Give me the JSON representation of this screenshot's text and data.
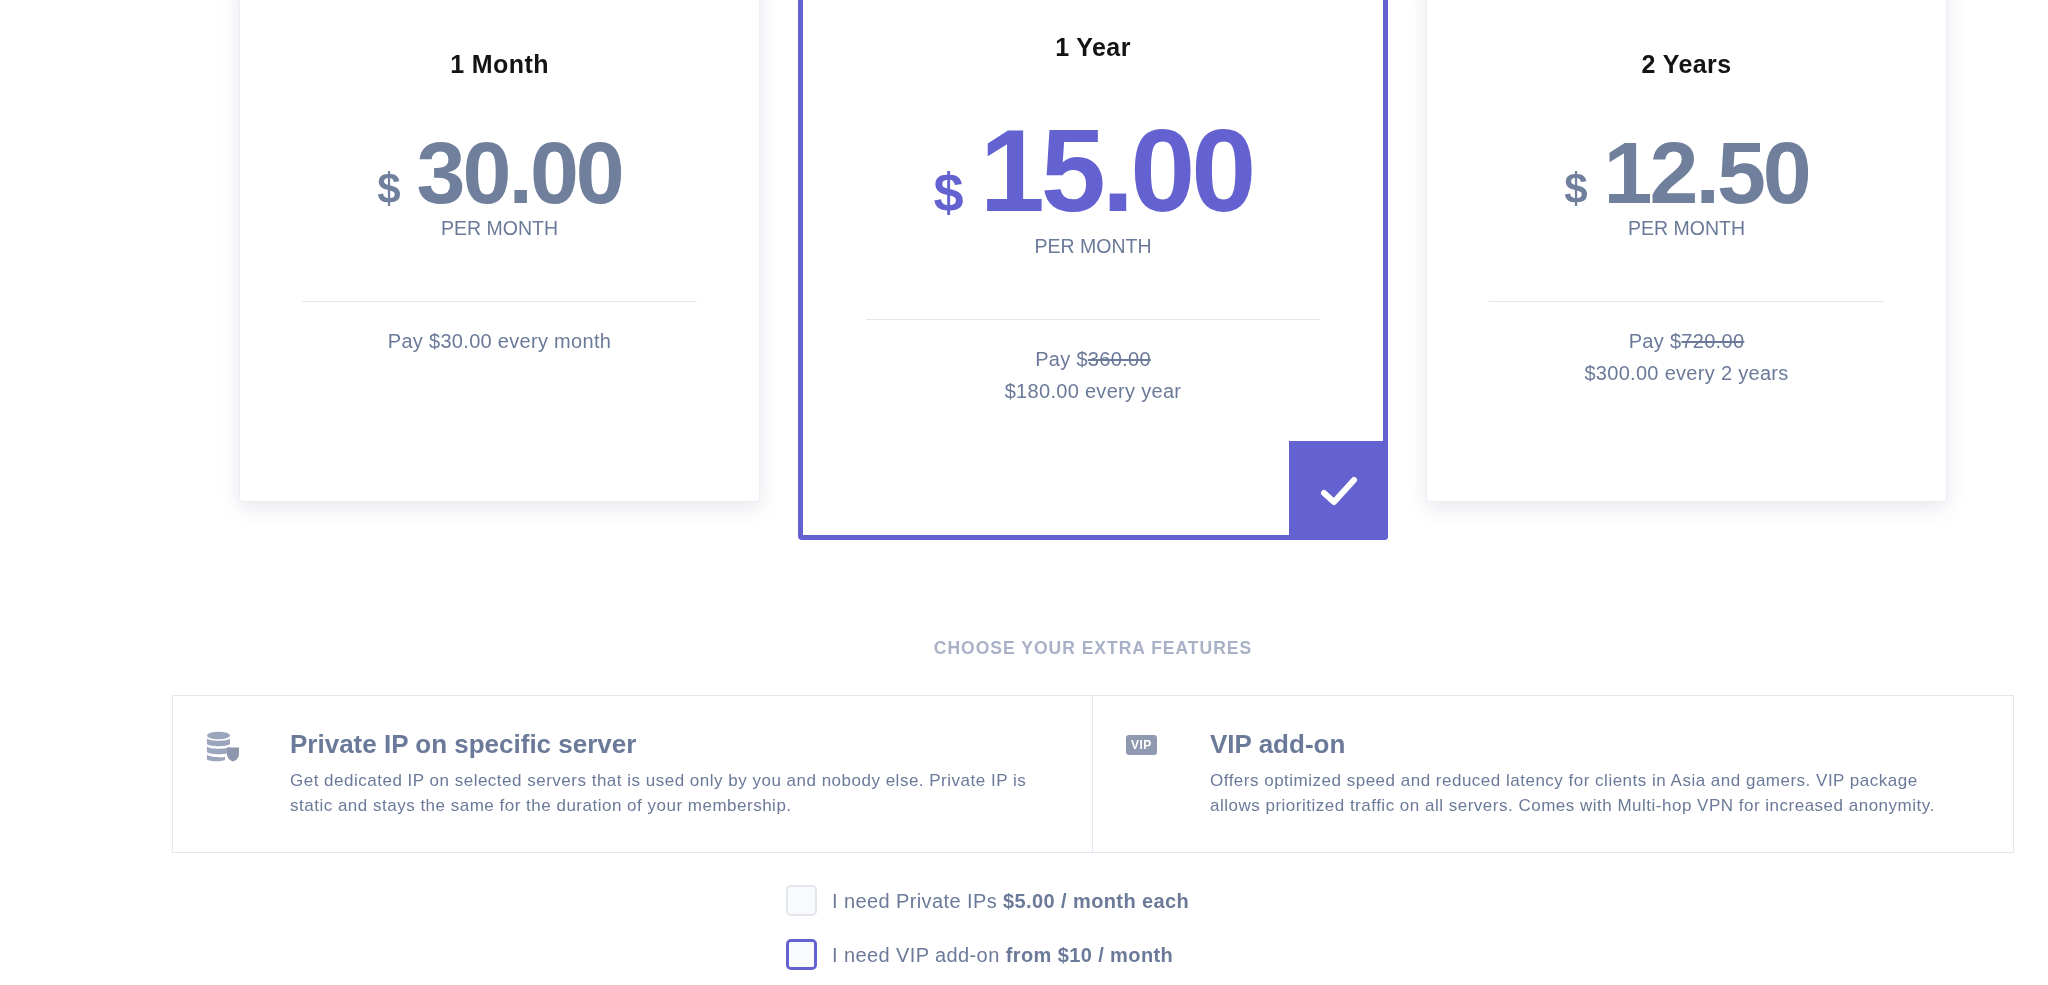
{
  "plans": [
    {
      "title": "1 Month",
      "currency": "$",
      "amount": "30.00",
      "period": "PER MONTH",
      "billing": {
        "text": "Pay $30.00 every month"
      },
      "selected": false
    },
    {
      "title": "1 Year",
      "currency": "$",
      "amount": "15.00",
      "period": "PER MONTH",
      "billing": {
        "text": "Pay $",
        "struck": "360.00",
        "after": "$180.00 every year"
      },
      "selected": true
    },
    {
      "title": "2 Years",
      "currency": "$",
      "amount": "12.50",
      "period": "PER MONTH",
      "billing": {
        "text": "Pay $",
        "struck": "720.00",
        "after": "$300.00 every 2 years"
      },
      "selected": false
    }
  ],
  "extras": {
    "heading": "CHOOSE YOUR EXTRA FEATURES",
    "features": [
      {
        "icon": {
          "kind": "database"
        },
        "title": "Private IP on specific server",
        "description": "Get dedicated IP on selected servers that is used only by you and nobody else. Private IP is static and stays the same for the duration of your membership."
      },
      {
        "icon": {
          "kind": "tag",
          "text": "VIP"
        },
        "title": "VIP add-on",
        "description": "Offers optimized speed and reduced latency for clients in Asia and gamers. VIP package allows prioritized traffic on all servers. Comes with Multi-hop VPN for increased anonymity."
      }
    ],
    "options": [
      {
        "label": "I need Private IPs **$5.00 / month each**",
        "checked": false,
        "focused": false
      },
      {
        "label": "I need VIP add-on **from $10 / month**",
        "checked": false,
        "focused": true
      }
    ]
  }
}
